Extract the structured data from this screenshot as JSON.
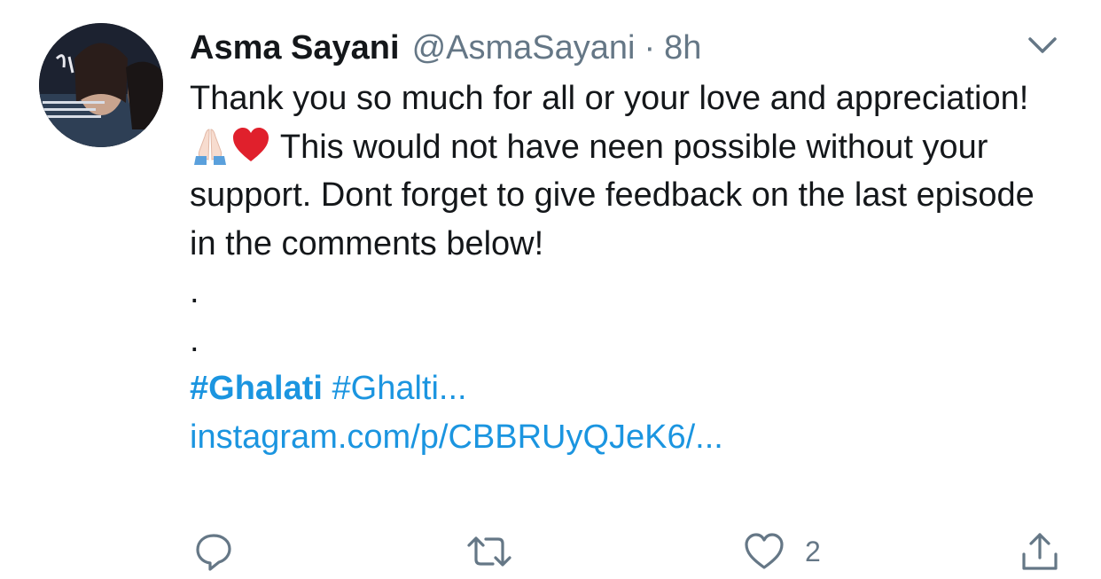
{
  "tweet": {
    "author_name": "Asma Sayani",
    "handle": "@AsmaSayani",
    "separator": "·",
    "time": "8h",
    "text_part1": "Thank you so much for all or your love and appreciation!",
    "emojis": [
      "folded-hands-icon",
      "red-heart-icon"
    ],
    "text_part2": "This would not have neen possible without your support. Dont forget to give feedback on the last episode in the comments below!",
    "dot_line_1": ".",
    "dot_line_2": ".",
    "hashtag_1": "#Ghalati",
    "hashtag_2": "#Ghalti...",
    "link": "instagram.com/p/CBBRUyQJeK6/..."
  },
  "actions": {
    "reply_icon": "reply-icon",
    "retweet_icon": "retweet-icon",
    "like_icon": "heart-icon",
    "like_count": "2",
    "share_icon": "share-icon"
  },
  "colors": {
    "link_blue": "#1b95e0",
    "secondary_gray": "#657786",
    "text_dark": "#14171a",
    "heart_red": "#e0245e"
  }
}
